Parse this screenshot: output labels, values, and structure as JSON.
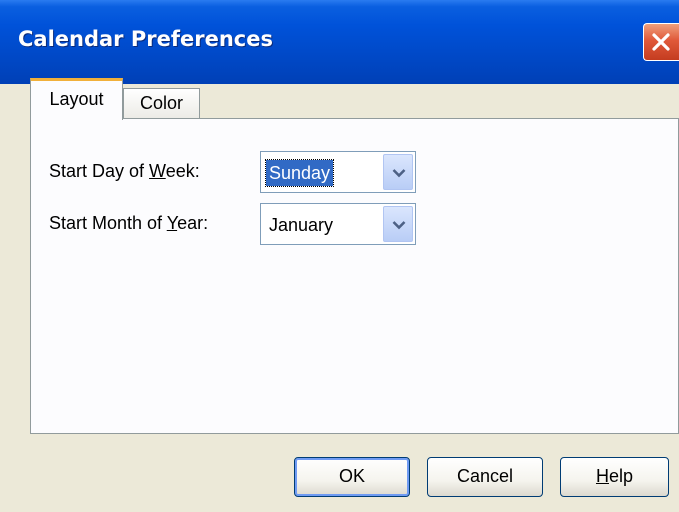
{
  "window": {
    "title": "Calendar Preferences"
  },
  "tabs": [
    {
      "label": "Layout",
      "active": true
    },
    {
      "label": "Color",
      "active": false
    }
  ],
  "fields": {
    "start_day": {
      "label_before": "Start Day of ",
      "label_underline": "W",
      "label_after": "eek:",
      "value": "Sunday"
    },
    "start_month": {
      "label_before": "Start Month of ",
      "label_underline": "Y",
      "label_after": "ear:",
      "value": "January"
    }
  },
  "buttons": {
    "ok": "OK",
    "cancel": "Cancel",
    "help_underline": "H",
    "help_rest": "elp"
  },
  "colors": {
    "titlebar": "#0052d9",
    "selection": "#316ac5",
    "active_tab_accent": "#f1b03a"
  },
  "icons": {
    "close": "close-icon",
    "dropdown": "chevron-down-icon"
  }
}
